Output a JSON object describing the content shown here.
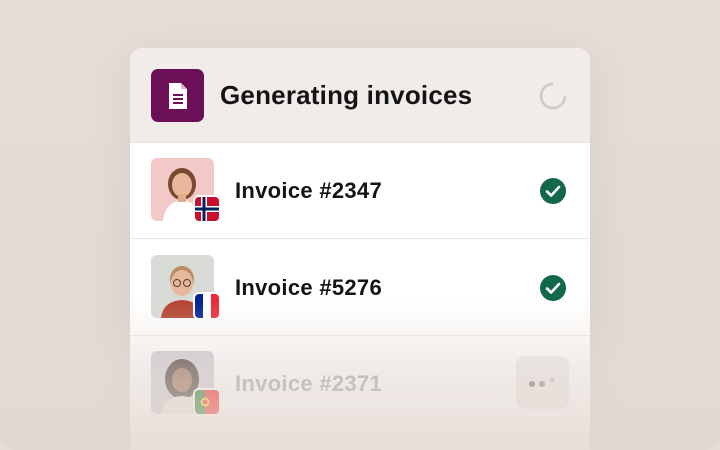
{
  "header": {
    "title": "Generating invoices",
    "icon": "document-icon",
    "accent_color": "#6b0f57",
    "status_icon": "loading-spinner-icon"
  },
  "invoices": [
    {
      "label": "Invoice #2347",
      "country_flag": "norway-flag-icon",
      "status": "complete",
      "status_icon": "check-circle-icon",
      "status_color": "#12694a"
    },
    {
      "label": "Invoice #5276",
      "country_flag": "france-flag-icon",
      "status": "complete",
      "status_icon": "check-circle-icon",
      "status_color": "#12694a"
    },
    {
      "label": "Invoice #2371",
      "country_flag": "portugal-flag-icon",
      "status": "in-progress",
      "status_icon": "loading-dots-icon"
    }
  ]
}
